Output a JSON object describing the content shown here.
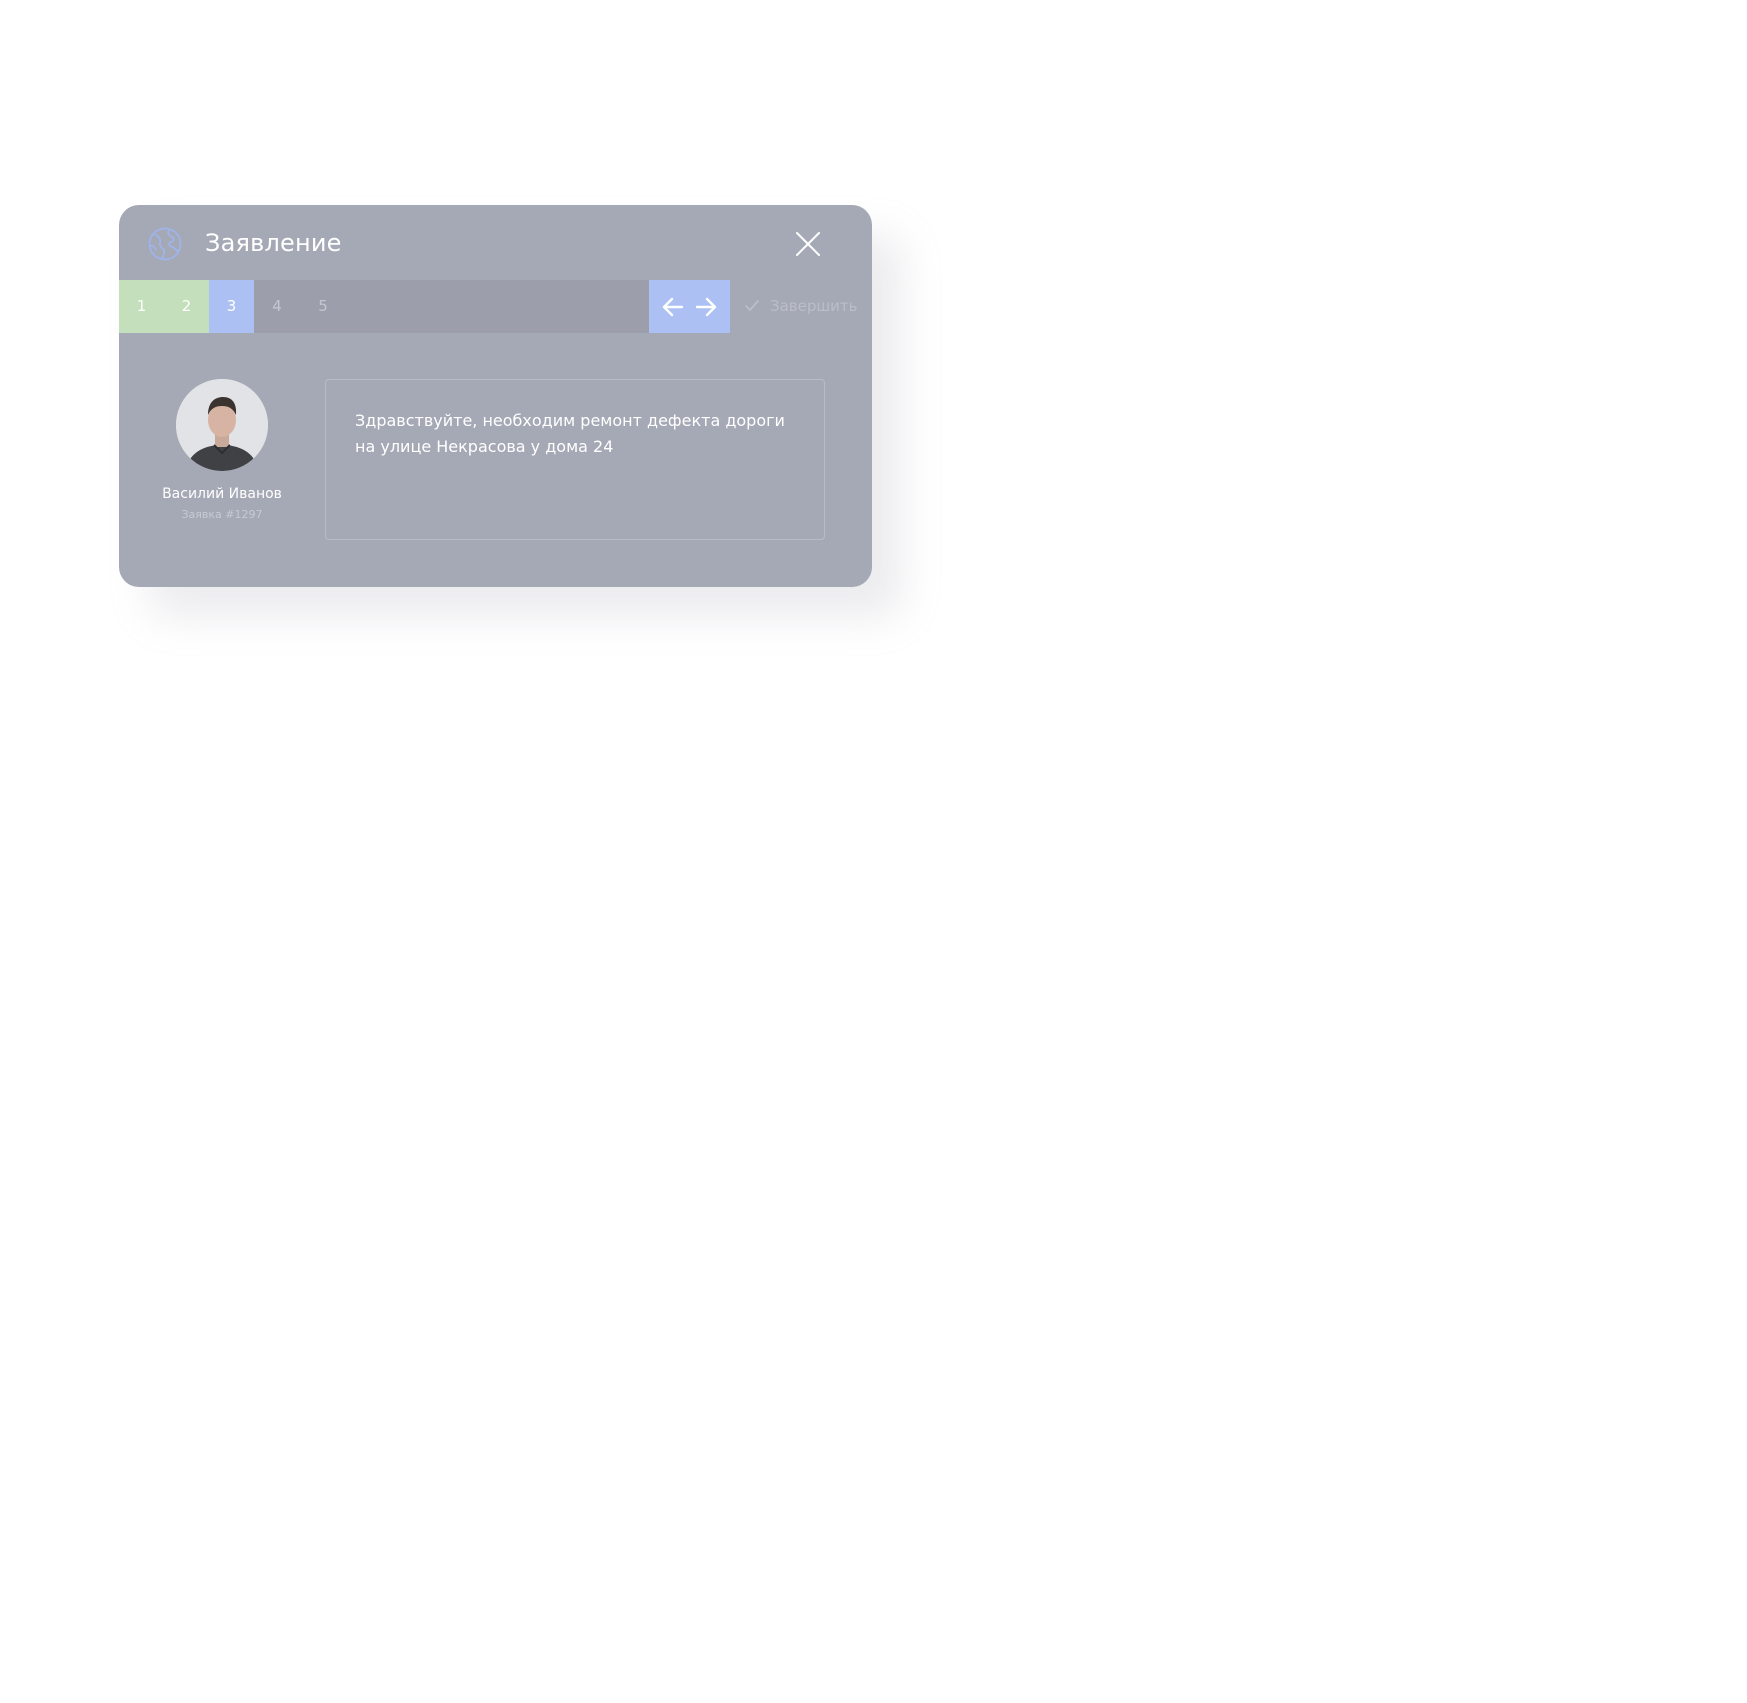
{
  "dialog": {
    "title": "Заявление",
    "logo_icon": "globe-icon",
    "close_icon": "close-icon"
  },
  "stepper": {
    "steps": [
      {
        "label": "1",
        "state": "done"
      },
      {
        "label": "2",
        "state": "done"
      },
      {
        "label": "3",
        "state": "active"
      },
      {
        "label": "4",
        "state": "pending"
      },
      {
        "label": "5",
        "state": "pending"
      }
    ],
    "prev_icon": "arrow-left-icon",
    "next_icon": "arrow-right-icon",
    "finish_icon": "checkmark-icon",
    "finish_label": "Завершить"
  },
  "user": {
    "name": "Василий Иванов",
    "ticket": "Заявка #1297"
  },
  "message": {
    "text": "Здравствуйте, необходим ремонт дефекта дороги на улице Некрасова у дома 24"
  },
  "colors": {
    "card_background": "#a5a9b5",
    "step_done": "#c3dfbb",
    "step_active": "#acc0f3",
    "accent_blue": "#acc0f3"
  }
}
